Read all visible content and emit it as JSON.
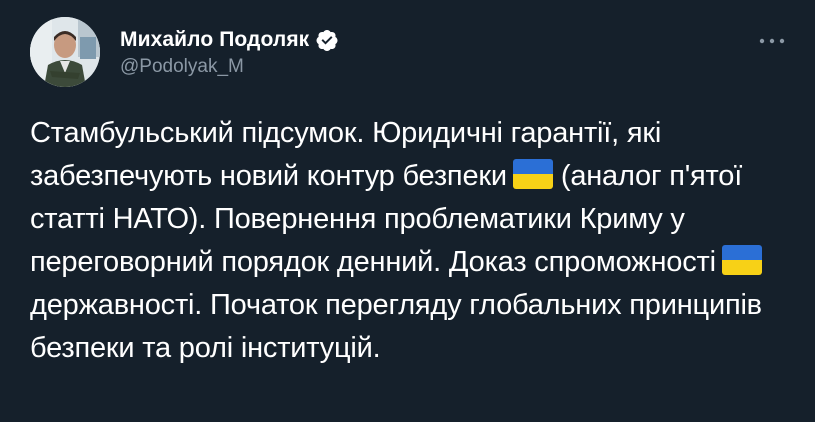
{
  "author": {
    "display_name": "Михайло Подоляк",
    "handle": "@Podolyak_M",
    "verified": true
  },
  "icons": {
    "verified": "verified-badge-icon",
    "more": "more-dots-icon",
    "flag": "ukraine-flag-emoji"
  },
  "colors": {
    "background": "#15202b",
    "text": "#ffffff",
    "secondary_text": "#8b98a5",
    "flag_blue": "#2b6fd6",
    "flag_yellow": "#f7d117"
  },
  "tweet": {
    "part1": "Стамбульський підсумок. Юридичні гарантії, які забезпечують новий контур безпеки",
    "part2": "(аналог п'ятої статті НАТО). Повернення проблематики Криму у переговорний порядок денний. Доказ спроможності",
    "part3": "державності. Початок перегляду глобальних принципів безпеки та ролі інституцій."
  }
}
